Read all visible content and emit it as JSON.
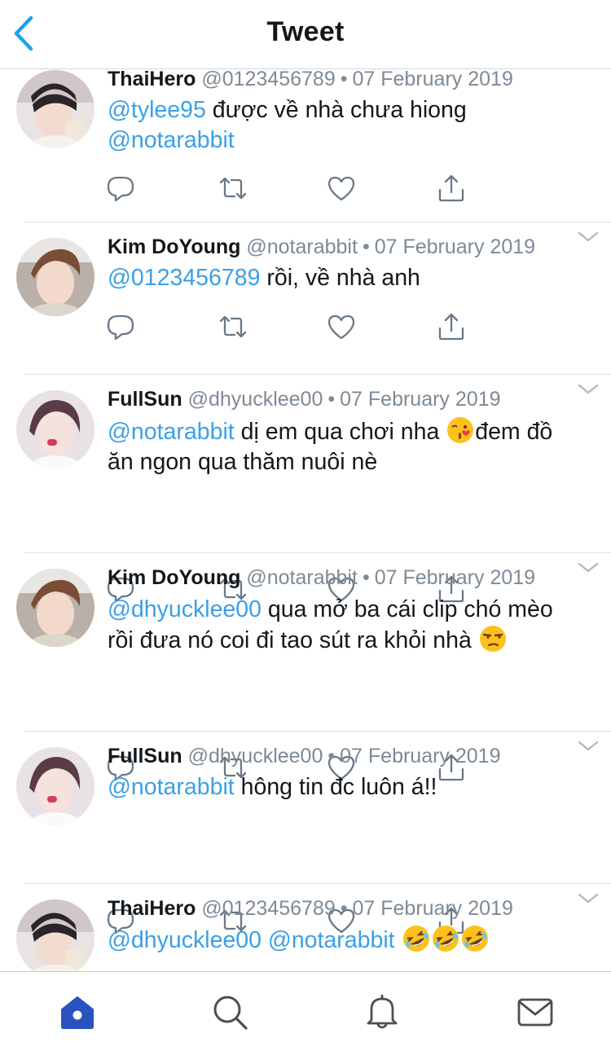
{
  "header": {
    "title": "Tweet",
    "back_icon": "chevron-left-icon"
  },
  "colors": {
    "accent": "#1da1f2",
    "mention": "#3aa0e6",
    "muted": "#7d8a96",
    "home_tab": "#2a52be"
  },
  "tweets": [
    {
      "name": "ThaiHero",
      "handle": "@0123456789",
      "date": "07 February 2019",
      "body_mention": "@tylee95",
      "body_line1_rest": " được về nhà chưa hiong",
      "body_line2_mention": "@notarabbit"
    },
    {
      "name": "Kim DoYoung",
      "handle": "@notarabbit",
      "date": "07 February 2019",
      "body_mention": "@0123456789",
      "body_line1_rest": " rồi, về nhà anh"
    },
    {
      "name": "FullSun",
      "handle": "@dhyucklee00",
      "date": "07 February 2019",
      "body_mention": "@notarabbit",
      "body_line1_rest": " dị em qua chơi nha ",
      "emoji": "face-blowing-kiss",
      "body_line1_after_emoji": "đem đồ",
      "body_line2": "ăn ngon qua thăm nuôi nè"
    },
    {
      "name": "Kim DoYoung",
      "handle": "@notarabbit",
      "date": "07 February 2019",
      "body_mention": "@dhyucklee00",
      "body_line1_rest": " qua mở ba cái clip chó mèo",
      "body_line2": "rồi đưa nó coi đi tao sút ra khỏi nhà ",
      "emoji": "unamused-face"
    },
    {
      "name": "FullSun",
      "handle": "@dhyucklee00",
      "date": "07 February 2019",
      "body_mention": "@notarabbit",
      "body_line1_rest": " hông tin đc luôn á!!"
    },
    {
      "name": "ThaiHero",
      "handle": "@0123456789",
      "date": "07 February 2019",
      "body_mention": "@dhyucklee00",
      "body_line1_mid": " ",
      "body_mention2": "@notarabbit",
      "body_line1_rest": " ",
      "emoji": "rolling-on-the-floor-laughing"
    }
  ],
  "tabbar": {
    "tabs": [
      "home-icon",
      "search-icon",
      "bell-icon",
      "mail-icon"
    ],
    "active": "home-icon"
  }
}
